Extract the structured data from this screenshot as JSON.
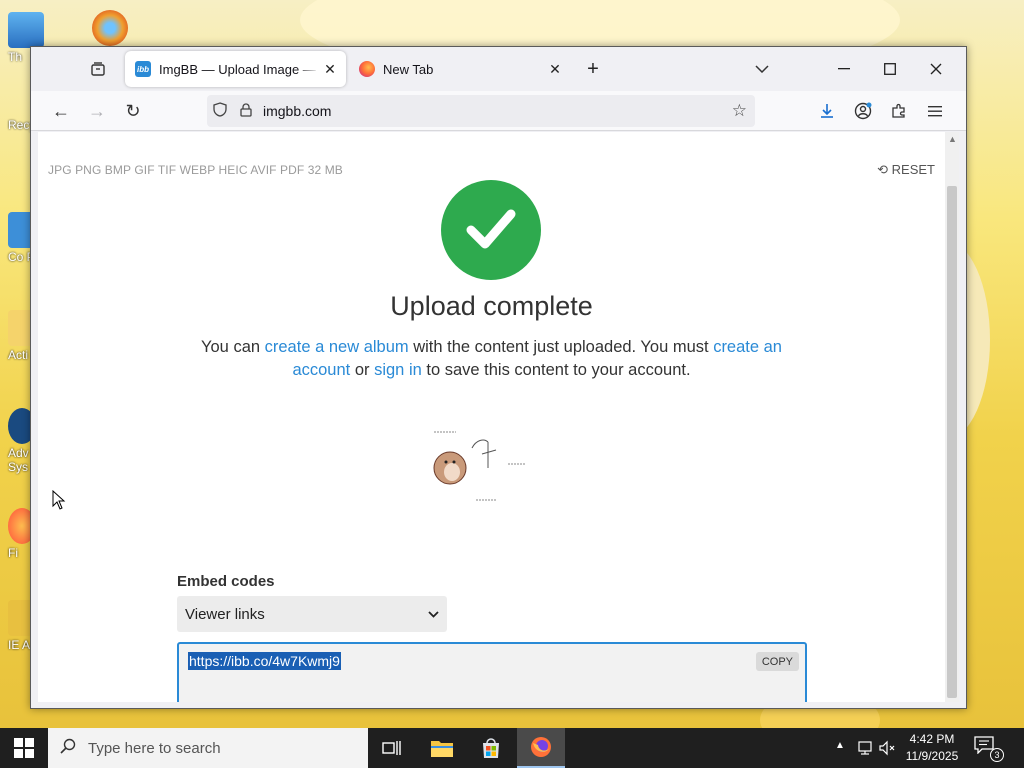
{
  "desktop": {
    "icons": [
      {
        "name": "this-pc",
        "label": "Th"
      },
      {
        "name": "recycle-bin",
        "label": "Recy"
      },
      {
        "name": "control-panel",
        "label": "Co P"
      },
      {
        "name": "folder",
        "label": "Acti"
      },
      {
        "name": "advanced-system",
        "label": "Adv Sys"
      },
      {
        "name": "firefox-shortcut",
        "label": "Fi"
      },
      {
        "name": "ie-shortcut",
        "label": "IE A"
      }
    ]
  },
  "browser": {
    "tabs": [
      {
        "title": "ImgBB — Upload Image — Free Image Hosting",
        "favicon": "imgbb-icon",
        "favicon_text": "ibb",
        "active": true
      },
      {
        "title": "New Tab",
        "favicon": "firefox-icon",
        "active": false
      }
    ],
    "url": "imgbb.com",
    "colors": {
      "accent": "#2a8ad6",
      "success": "#2eaa4e"
    }
  },
  "page": {
    "formats": "JPG PNG BMP GIF TIF WEBP HEIC AVIF PDF  32 MB",
    "reset_label": "RESET",
    "heading": "Upload complete",
    "msg_part1": "You can ",
    "link_album": "create a new album",
    "msg_part2": " with the content just uploaded. You must ",
    "link_account": "create an account",
    "msg_part3": " or ",
    "link_signin": "sign in",
    "msg_part4": " to save this content to your account.",
    "embed_label": "Embed codes",
    "embed_select": "Viewer links",
    "embed_link": "https://ibb.co/4w7Kwmj9",
    "copy_label": "COPY"
  },
  "taskbar": {
    "search_placeholder": "Type here to search",
    "time": "4:42 PM",
    "date": "11/9/2025",
    "notifications": "3"
  }
}
